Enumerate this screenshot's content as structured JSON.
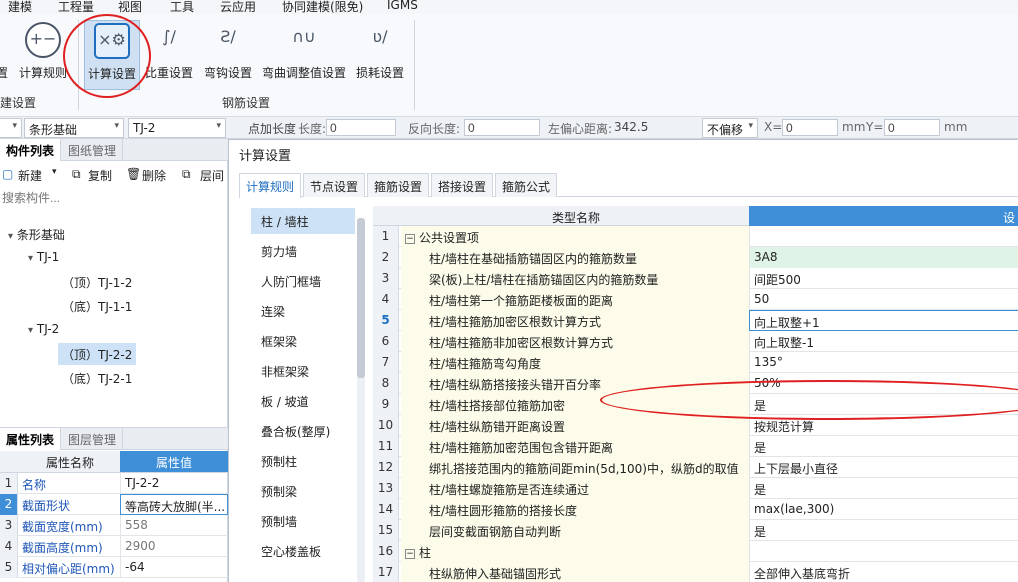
{
  "menu": [
    "建模",
    "工程量",
    "视图",
    "工具",
    "云应用",
    "协同建模(限免)",
    "IGMS"
  ],
  "ribbon": {
    "buttons": [
      {
        "label": "置",
        "icon": "settings-partial-icon"
      },
      {
        "label": "计算规则",
        "icon": "plus-minus-icon"
      },
      {
        "label": "计算设置",
        "icon": "calc-settings-icon"
      },
      {
        "label": "比重设置",
        "icon": "weight-icon"
      },
      {
        "label": "弯钩设置",
        "icon": "hook-icon"
      },
      {
        "label": "弯曲调整值设置",
        "icon": "bend-icon"
      },
      {
        "label": "损耗设置",
        "icon": "loss-icon"
      }
    ],
    "groups": [
      "建设置",
      "钢筋设置"
    ]
  },
  "propbar": {
    "type": "条形基础",
    "name": "TJ-2",
    "point_length_label": "点加长度",
    "length_label": "长度:",
    "length_value": "0",
    "reverse_label": "反向长度:",
    "reverse_value": "0",
    "offset_label": "左偏心距离:",
    "offset_value": "342.5",
    "no_offset": "不偏移",
    "x_label": "X=",
    "x_value": "0",
    "unit": "mm",
    "y_label": "Y=",
    "y_value": "0",
    "unit2": "mm"
  },
  "component_panel": {
    "tabs": [
      "构件列表",
      "图纸管理"
    ],
    "tools": [
      "新建",
      "复制",
      "删除",
      "层间"
    ],
    "search_placeholder": "搜索构件...",
    "tree": [
      {
        "label": "条形基础",
        "level": 0,
        "caret": "▾"
      },
      {
        "label": "TJ-1",
        "level": 1,
        "caret": "▾"
      },
      {
        "label": "（顶）TJ-1-2",
        "level": 2
      },
      {
        "label": "（底）TJ-1-1",
        "level": 2
      },
      {
        "label": "TJ-2",
        "level": 1,
        "caret": "▾"
      },
      {
        "label": "（顶）TJ-2-2",
        "level": 2,
        "selected": true
      },
      {
        "label": "（底）TJ-2-1",
        "level": 2
      }
    ]
  },
  "property_panel": {
    "tabs": [
      "属性列表",
      "图层管理"
    ],
    "headers": [
      "属性名称",
      "属性值"
    ],
    "rows": [
      {
        "n": "1",
        "k": "名称",
        "v": "TJ-2-2"
      },
      {
        "n": "2",
        "k": "截面形状",
        "v": "等高砖大放脚(半..."
      },
      {
        "n": "3",
        "k": "截面宽度(mm)",
        "v": "558"
      },
      {
        "n": "4",
        "k": "截面高度(mm)",
        "v": "2900"
      },
      {
        "n": "5",
        "k": "相对偏心距(mm)",
        "v": "-64"
      }
    ]
  },
  "dialog": {
    "title": "计算设置",
    "tabs": [
      "计算规则",
      "节点设置",
      "箍筋设置",
      "搭接设置",
      "箍筋公式"
    ],
    "categories": [
      "柱 / 墙柱",
      "剪力墙",
      "人防门框墙",
      "连梁",
      "框架梁",
      "非框架梁",
      "板 / 坡道",
      "叠合板(整厚)",
      "预制柱",
      "预制梁",
      "预制墙",
      "空心楼盖板"
    ],
    "grid_headers": [
      "类型名称",
      "设"
    ],
    "rows": [
      {
        "n": "1",
        "name": "公共设置项",
        "val": "",
        "group": true
      },
      {
        "n": "2",
        "name": "柱/墙柱在基础插筋锚固区内的箍筋数量",
        "val": "3A8",
        "green": true
      },
      {
        "n": "3",
        "name": "梁(板)上柱/墙柱在插筋锚固区内的箍筋数量",
        "val": "间距500"
      },
      {
        "n": "4",
        "name": "柱/墙柱第一个箍筋距楼板面的距离",
        "val": "50"
      },
      {
        "n": "5",
        "name": "柱/墙柱箍筋加密区根数计算方式",
        "val": "向上取整+1",
        "edit": true
      },
      {
        "n": "6",
        "name": "柱/墙柱箍筋非加密区根数计算方式",
        "val": "向上取整-1"
      },
      {
        "n": "7",
        "name": "柱/墙柱箍筋弯勾角度",
        "val": "135°"
      },
      {
        "n": "8",
        "name": "柱/墙柱纵筋搭接接头错开百分率",
        "val": "50%"
      },
      {
        "n": "9",
        "name": "柱/墙柱搭接部位箍筋加密",
        "val": "是"
      },
      {
        "n": "10",
        "name": "柱/墙柱纵筋错开距离设置",
        "val": "按规范计算"
      },
      {
        "n": "11",
        "name": "柱/墙柱箍筋加密范围包含错开距离",
        "val": "是"
      },
      {
        "n": "12",
        "name": "绑扎搭接范围内的箍筋间距min(5d,100)中，纵筋d的取值",
        "val": "上下层最小直径"
      },
      {
        "n": "13",
        "name": "柱/墙柱螺旋箍筋是否连续通过",
        "val": "是"
      },
      {
        "n": "14",
        "name": "柱/墙柱圆形箍筋的搭接长度",
        "val": "max(lae,300)"
      },
      {
        "n": "15",
        "name": "层间变截面钢筋自动判断",
        "val": "是"
      },
      {
        "n": "16",
        "name": "柱",
        "val": "",
        "group": true
      },
      {
        "n": "17",
        "name": "柱纵筋伸入基础锚固形式",
        "val": "全部伸入基底弯折"
      }
    ]
  }
}
